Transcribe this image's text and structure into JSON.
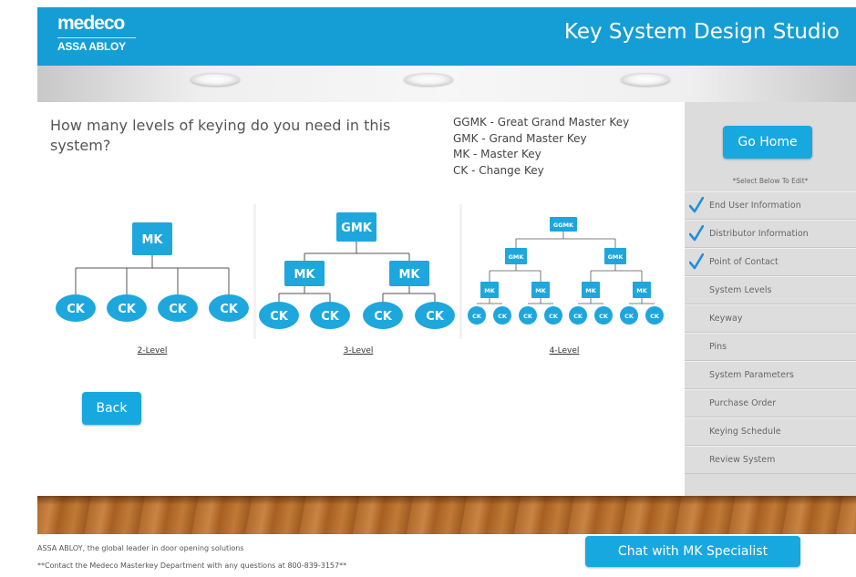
{
  "header": {
    "logo_main": "medeco",
    "logo_sub": "ASSA ABLOY",
    "title": "Key System Design Studio"
  },
  "question": "How many levels of keying do you need in this system?",
  "legend": [
    "GGMK - Great Grand Master Key",
    "GMK - Grand Master Key",
    "MK - Master Key",
    "CK - Change Key"
  ],
  "diagrams": [
    {
      "label": "2-Level"
    },
    {
      "label": "3-Level"
    },
    {
      "label": "4-Level"
    }
  ],
  "node_labels": {
    "ggmk": "GGMK",
    "gmk": "GMK",
    "mk": "MK",
    "ck": "CK"
  },
  "back_label": "Back",
  "sidebar": {
    "go_home": "Go Home",
    "select_note": "*Select Below To Edit*",
    "items": [
      {
        "label": "End User Information",
        "checked": true
      },
      {
        "label": "Distributor Information",
        "checked": true
      },
      {
        "label": "Point of Contact",
        "checked": true
      },
      {
        "label": "System Levels",
        "checked": false
      },
      {
        "label": "Keyway",
        "checked": false
      },
      {
        "label": "Pins",
        "checked": false
      },
      {
        "label": "System Parameters",
        "checked": false
      },
      {
        "label": "Purchase Order",
        "checked": false
      },
      {
        "label": "Keying Schedule",
        "checked": false
      },
      {
        "label": "Review System",
        "checked": false
      }
    ]
  },
  "footer": {
    "tagline": "ASSA ABLOY, the global leader in door opening solutions",
    "contact": "**Contact the Medeco Masterkey Department with any questions at 800-839-3157**",
    "chat_label": "Chat with MK Specialist"
  },
  "colors": {
    "brand_blue": "#159ed6",
    "button_blue": "#18a8e0",
    "check_blue": "#1e90dd"
  },
  "icons": [
    "check-icon",
    "ceiling-lamp"
  ]
}
